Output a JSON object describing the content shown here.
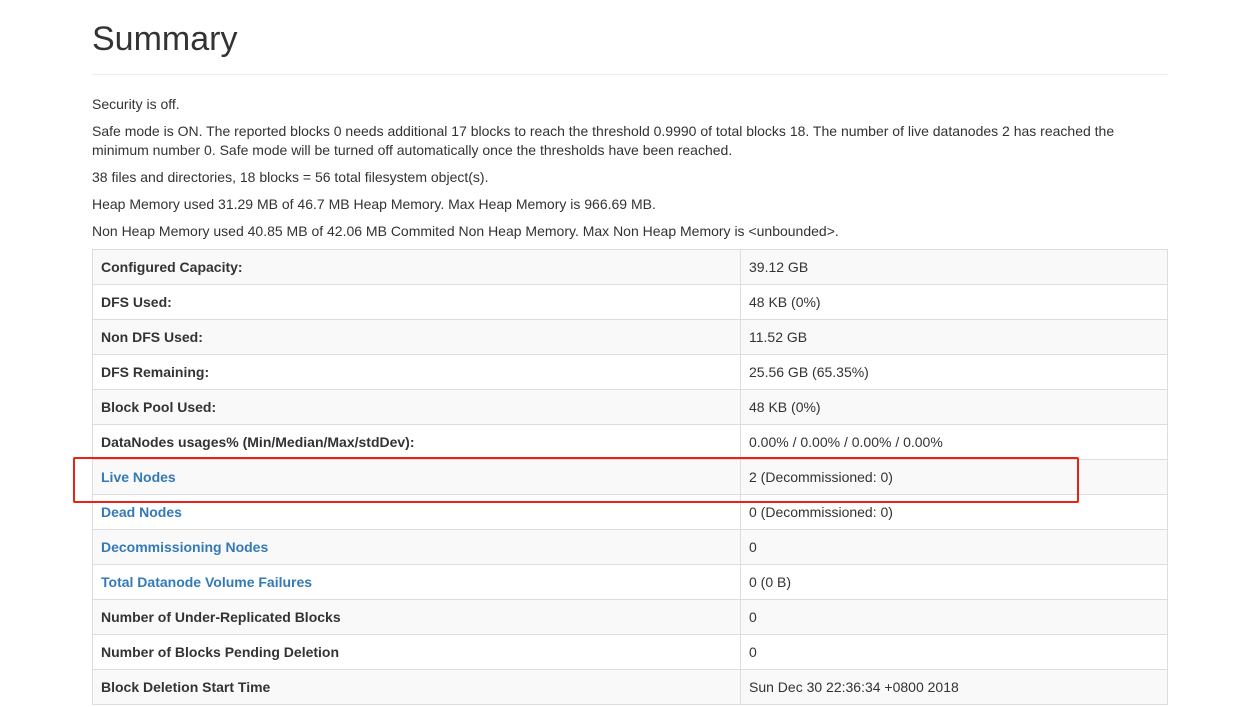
{
  "page": {
    "title": "Summary"
  },
  "info": {
    "security": "Security is off.",
    "safemode": "Safe mode is ON. The reported blocks 0 needs additional 17 blocks to reach the threshold 0.9990 of total blocks 18. The number of live datanodes 2 has reached the minimum number 0. Safe mode will be turned off automatically once the thresholds have been reached.",
    "files": "38 files and directories, 18 blocks = 56 total filesystem object(s).",
    "heap": "Heap Memory used 31.29 MB of 46.7 MB Heap Memory. Max Heap Memory is 966.69 MB.",
    "nonheap": "Non Heap Memory used 40.85 MB of 42.06 MB Commited Non Heap Memory. Max Non Heap Memory is <unbounded>."
  },
  "table": {
    "rows": [
      {
        "key": "Configured Capacity:",
        "value": "39.12 GB"
      },
      {
        "key": "DFS Used:",
        "value": "48 KB (0%)"
      },
      {
        "key": "Non DFS Used:",
        "value": "11.52 GB"
      },
      {
        "key": "DFS Remaining:",
        "value": "25.56 GB (65.35%)"
      },
      {
        "key": "Block Pool Used:",
        "value": "48 KB (0%)"
      },
      {
        "key": "DataNodes usages% (Min/Median/Max/stdDev):",
        "value": "0.00% / 0.00% / 0.00% / 0.00%"
      },
      {
        "key": "Live Nodes",
        "value": "2 (Decommissioned: 0)"
      },
      {
        "key": "Dead Nodes",
        "value": "0 (Decommissioned: 0)"
      },
      {
        "key": "Decommissioning Nodes",
        "value": "0"
      },
      {
        "key": "Total Datanode Volume Failures",
        "value": "0 (0 B)"
      },
      {
        "key": "Number of Under-Replicated Blocks",
        "value": "0"
      },
      {
        "key": "Number of Blocks Pending Deletion",
        "value": "0"
      },
      {
        "key": "Block Deletion Start Time",
        "value": "Sun Dec 30 22:36:34 +0800 2018"
      }
    ]
  },
  "colors": {
    "link": "#337ab7",
    "highlight": "#e8211a",
    "stripe": "#f9f9f9",
    "border": "#dddddd"
  }
}
